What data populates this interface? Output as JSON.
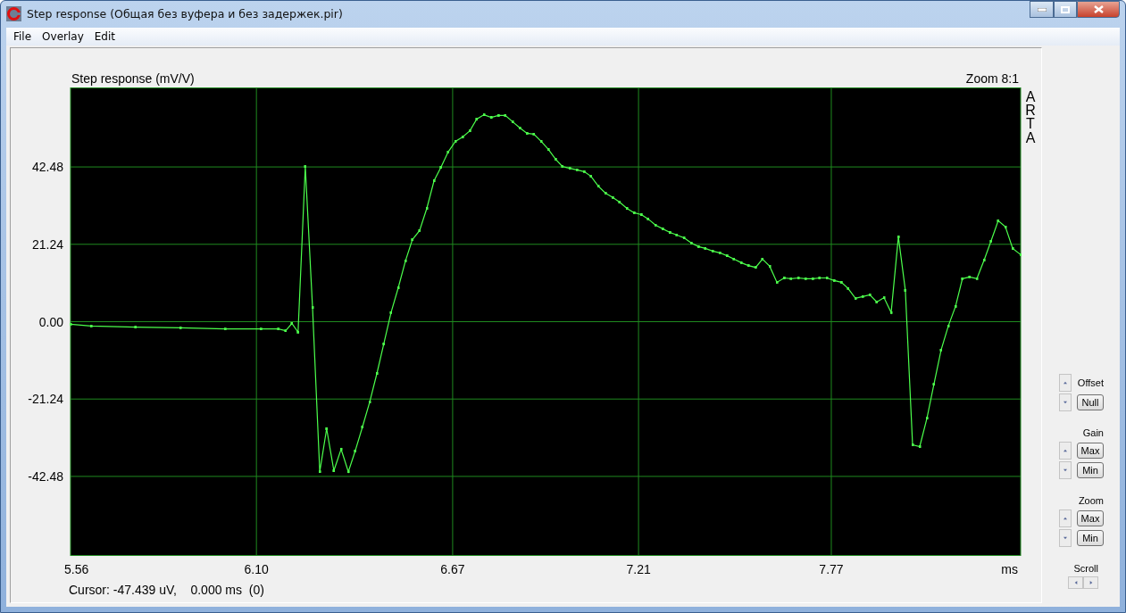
{
  "window": {
    "title": "Step response (Общая без вуфера и без задержек.pir)"
  },
  "menu": [
    "File",
    "Overlay",
    "Edit"
  ],
  "plot": {
    "title": "Step response (mV/V)",
    "zoom": "Zoom 8:1",
    "brand": "ARTA",
    "cursor": "Cursor: -47.439 uV,    0.000 ms  (0)",
    "chart_data": {
      "type": "line",
      "grid": true,
      "xlabel": "ms",
      "xlim": [
        5.56,
        8.32
      ],
      "ylim": [
        -64.3,
        64.3
      ],
      "xticks": [
        {
          "value": 5.56,
          "label": "5.56"
        },
        {
          "value": 6.1,
          "label": "6.10"
        },
        {
          "value": 6.67,
          "label": "6.67"
        },
        {
          "value": 7.21,
          "label": "7.21"
        },
        {
          "value": 7.77,
          "label": "7.77"
        }
      ],
      "yticks": [
        {
          "value": 42.48,
          "label": "42.48"
        },
        {
          "value": 21.24,
          "label": "21.24"
        },
        {
          "value": 0,
          "label": "0.00"
        },
        {
          "value": -21.24,
          "label": "-21.24"
        },
        {
          "value": -42.48,
          "label": "-42.48"
        }
      ],
      "x": [
        5.56,
        5.62,
        5.749,
        5.879,
        6.009,
        6.113,
        6.164,
        6.185,
        6.203,
        6.221,
        6.242,
        6.263,
        6.284,
        6.304,
        6.325,
        6.346,
        6.367,
        6.387,
        6.408,
        6.429,
        6.45,
        6.47,
        6.491,
        6.512,
        6.533,
        6.553,
        6.574,
        6.595,
        6.616,
        6.636,
        6.657,
        6.678,
        6.699,
        6.72,
        6.74,
        6.761,
        6.782,
        6.803,
        6.823,
        6.844,
        6.865,
        6.886,
        6.906,
        6.927,
        6.948,
        6.969,
        6.989,
        7.01,
        7.031,
        7.052,
        7.072,
        7.093,
        7.114,
        7.135,
        7.155,
        7.176,
        7.197,
        7.218,
        7.238,
        7.259,
        7.28,
        7.301,
        7.321,
        7.342,
        7.363,
        7.384,
        7.404,
        7.425,
        7.446,
        7.467,
        7.487,
        7.508,
        7.529,
        7.55,
        7.57,
        7.591,
        7.612,
        7.633,
        7.653,
        7.674,
        7.695,
        7.716,
        7.736,
        7.757,
        7.778,
        7.799,
        7.819,
        7.84,
        7.861,
        7.882,
        7.902,
        7.923,
        7.944,
        7.965,
        7.985,
        8.006,
        8.027,
        8.048,
        8.068,
        8.089,
        8.11,
        8.131,
        8.151,
        8.172,
        8.193,
        8.214,
        8.234,
        8.255,
        8.276,
        8.297,
        8.32
      ],
      "values": [
        -0.7,
        -1.2,
        -1.5,
        -1.7,
        -2.0,
        -2.0,
        -2.0,
        -2.5,
        -0.5,
        -2.9,
        42.6,
        3.9,
        -41.2,
        -29.4,
        -40.9,
        -35.0,
        -41.2,
        -35.5,
        -28.9,
        -22.1,
        -14.2,
        -6.1,
        2.5,
        9.3,
        16.7,
        22.5,
        25.0,
        31.1,
        38.7,
        42.4,
        46.6,
        49.5,
        50.7,
        52.4,
        55.6,
        56.8,
        56.1,
        56.6,
        56.6,
        54.9,
        53.2,
        51.7,
        51.5,
        49.5,
        47.3,
        44.6,
        42.6,
        42.1,
        41.7,
        41.2,
        39.9,
        37.2,
        35.3,
        34.1,
        32.8,
        31.1,
        29.9,
        29.4,
        28.2,
        26.5,
        25.5,
        24.5,
        23.8,
        23.0,
        21.6,
        20.6,
        20.1,
        19.4,
        18.9,
        18.1,
        17.2,
        16.2,
        15.4,
        14.9,
        17.2,
        15.2,
        10.8,
        12.0,
        11.8,
        12.0,
        11.8,
        11.8,
        12.0,
        12.0,
        11.3,
        10.8,
        9.1,
        6.4,
        6.9,
        7.4,
        5.4,
        6.6,
        2.5,
        23.3,
        8.6,
        -33.8,
        -34.3,
        -26.5,
        -17.2,
        -7.8,
        -1.2,
        4.2,
        11.8,
        12.3,
        11.8,
        16.9,
        22.1,
        27.7,
        26.0,
        20.1,
        18.4
      ]
    }
  },
  "controls": [
    {
      "kind": "inline",
      "label": "Offset",
      "buttons": [
        "Null"
      ]
    },
    {
      "kind": "above",
      "label": "Gain",
      "buttons": [
        "Max",
        "Min"
      ]
    },
    {
      "kind": "above",
      "label": "Zoom",
      "buttons": [
        "Max",
        "Min"
      ]
    },
    {
      "kind": "scroll",
      "label": "Scroll"
    }
  ]
}
